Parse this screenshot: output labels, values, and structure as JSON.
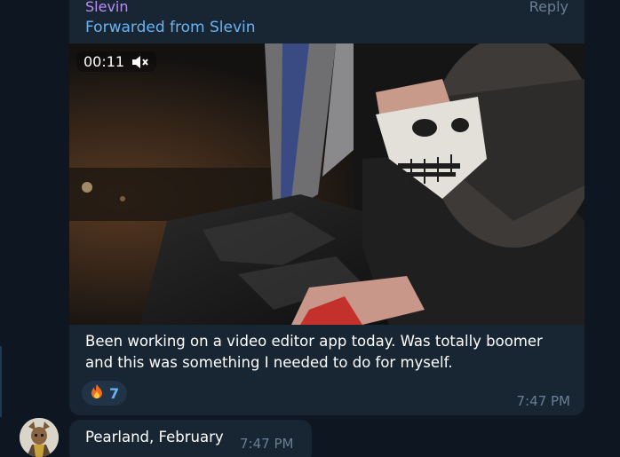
{
  "message": {
    "sender": "Slevin",
    "reply_label": "Reply",
    "forwarded_label": "Forwarded from Slevin",
    "video": {
      "duration": "00:11",
      "muted_icon": "speaker-muted-icon"
    },
    "caption": "Been working on a video editor app today. Was totally boomer and this was something I needed to do for myself.",
    "reaction": {
      "emoji_icon": "fire-icon",
      "count": "7"
    },
    "time": "7:47 PM"
  },
  "next_message": {
    "text": "Pearland, February",
    "time": "7:47 PM"
  },
  "colors": {
    "background": "#0e1621",
    "bubble": "#182533",
    "sender_name": "#b990f0",
    "forwarded": "#6ab3f3",
    "meta": "#6b7f92",
    "reaction_bg": "#203347"
  }
}
